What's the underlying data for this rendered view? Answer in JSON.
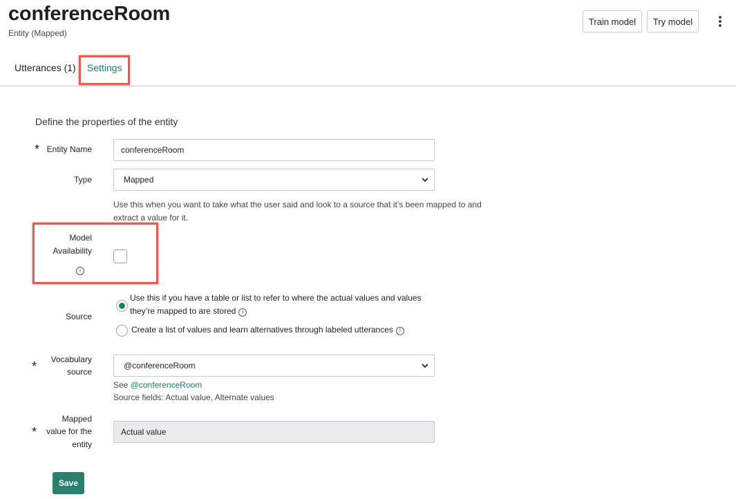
{
  "header": {
    "title": "conferenceRoom",
    "subtitle": "Entity (Mapped)",
    "train_label": "Train model",
    "try_label": "Try model"
  },
  "tabs": [
    {
      "label": "Utterances (1)",
      "active": false
    },
    {
      "label": "Settings",
      "active": true
    }
  ],
  "form": {
    "heading": "Define the properties of the entity",
    "entity_name": {
      "label": "Entity Name",
      "value": "conferenceRoom",
      "required": true
    },
    "type": {
      "label": "Type",
      "value": "Mapped",
      "help": "Use this when you want to take what the user said and look to a source that it’s been mapped to and extract a value for it."
    },
    "model_availability": {
      "label_line1": "Model",
      "label_line2": "Availability",
      "checked": false
    },
    "source": {
      "label": "Source",
      "options": [
        {
          "text": "Use this if you have a table or list to refer to where the actual values and values they’re mapped to are stored",
          "checked": true
        },
        {
          "text": "Create a list of values and learn alternatives through labeled utterances",
          "checked": false
        }
      ]
    },
    "vocabulary_source": {
      "label_line1": "Vocabulary",
      "label_line2": "source",
      "value": "@conferenceRoom",
      "see_prefix": "See",
      "see_link": "@conferenceRoom",
      "source_fields": "Source fields: Actual value, Alternate values",
      "required": true
    },
    "mapped_value": {
      "label_line1": "Mapped",
      "label_line2": "value for the",
      "label_line3": "entity",
      "value": "Actual value",
      "required": true
    },
    "save_label": "Save"
  },
  "colors": {
    "accent": "#1c7a6a",
    "highlight": "#e35d55",
    "save": "#2a7f6f"
  }
}
